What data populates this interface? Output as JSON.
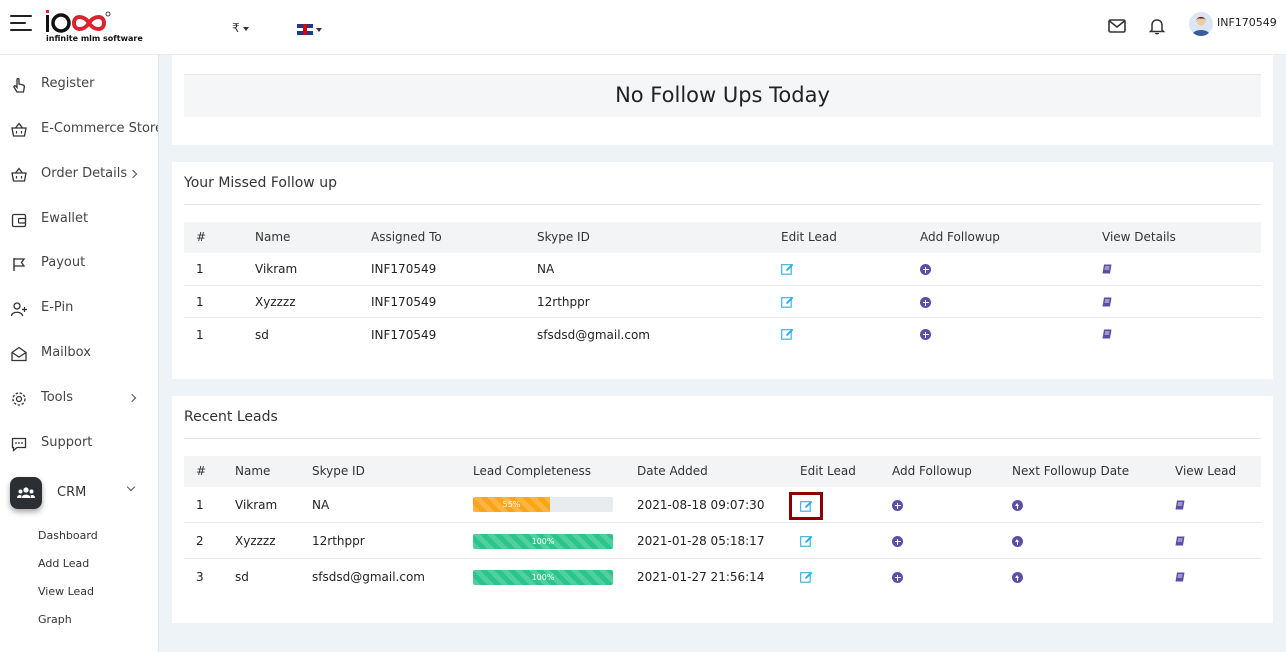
{
  "header": {
    "logo_brand": "1000",
    "logo_tagline": "infinite mlm software",
    "currency_symbol": "₹",
    "username": "INF170549"
  },
  "sidebar": {
    "items": [
      {
        "label": "Register",
        "icon": "hand-pointer-icon"
      },
      {
        "label": "E-Commerce Store",
        "icon": "basket-icon"
      },
      {
        "label": "Order Details",
        "icon": "basket-icon"
      },
      {
        "label": "Ewallet",
        "icon": "wallet-icon"
      },
      {
        "label": "Payout",
        "icon": "flag-icon"
      },
      {
        "label": "E-Pin",
        "icon": "user-plus-icon"
      },
      {
        "label": "Mailbox",
        "icon": "envelope-open-icon"
      },
      {
        "label": "Tools",
        "icon": "gear-icon"
      },
      {
        "label": "Support",
        "icon": "chat-icon"
      }
    ],
    "crm": {
      "label": "CRM",
      "sub_items": [
        "Dashboard",
        "Add Lead",
        "View Lead",
        "Graph"
      ]
    }
  },
  "follow_ups_today": {
    "empty_message": "No Follow Ups Today"
  },
  "missed_follow_up": {
    "title": "Your Missed Follow up",
    "columns": [
      "#",
      "Name",
      "Assigned To",
      "Skype ID",
      "Edit Lead",
      "Add Followup",
      "View Details"
    ],
    "rows": [
      {
        "num": "1",
        "name": "Vikram",
        "assigned_to": "INF170549",
        "skype": "NA"
      },
      {
        "num": "1",
        "name": "Xyzzzz",
        "assigned_to": "INF170549",
        "skype": "12rthppr"
      },
      {
        "num": "1",
        "name": "sd",
        "assigned_to": "INF170549",
        "skype": "sfsdsd@gmail.com"
      }
    ]
  },
  "recent_leads": {
    "title": "Recent Leads",
    "columns": [
      "#",
      "Name",
      "Skype ID",
      "Lead Completeness",
      "Date Added",
      "Edit Lead",
      "Add Followup",
      "Next Followup Date",
      "View Lead"
    ],
    "rows": [
      {
        "num": "1",
        "name": "Vikram",
        "skype": "NA",
        "completeness": 55,
        "completeness_label": "55%",
        "date_added": "2021-08-18 09:07:30"
      },
      {
        "num": "2",
        "name": "Xyzzzz",
        "skype": "12rthppr",
        "completeness": 100,
        "completeness_label": "100%",
        "date_added": "2021-01-28 05:18:17"
      },
      {
        "num": "3",
        "name": "sd",
        "skype": "sfsdsd@gmail.com",
        "completeness": 100,
        "completeness_label": "100%",
        "date_added": "2021-01-27 21:56:14"
      }
    ]
  },
  "colors": {
    "accent_purple": "#5a4fa6",
    "edit_blue": "#2eaee0",
    "progress_orange": "#f9a51a",
    "progress_green": "#2bc48a",
    "highlight": "#8b0000"
  }
}
